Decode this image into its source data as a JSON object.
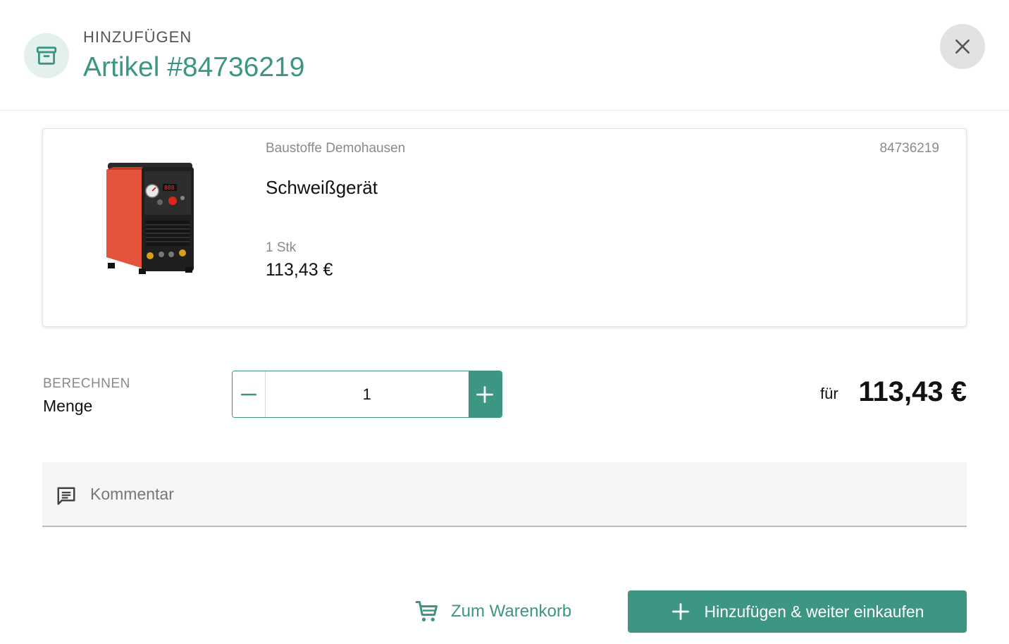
{
  "dialog": {
    "overline": "HINZUFÜGEN",
    "title": "Artikel #84736219",
    "icon": "archive-box-icon",
    "close_icon": "close-icon"
  },
  "product": {
    "supplier": "Baustoffe Demohausen",
    "article_number": "84736219",
    "name": "Schweißgerät",
    "unit": "1 Stk",
    "unit_price": "113,43 €",
    "image": "welding-machine-image"
  },
  "calculation": {
    "overline": "BERECHNEN",
    "label": "Menge",
    "quantity": "1",
    "minus_icon": "minus-icon",
    "plus_icon": "plus-icon",
    "for_label": "für",
    "total": "113,43 €"
  },
  "comment": {
    "placeholder": "Kommentar",
    "value": "",
    "icon": "comment-icon"
  },
  "actions": {
    "cart_label": "Zum Warenkorb",
    "cart_icon": "shopping-cart-icon",
    "add_label": "Hinzufügen & weiter einkaufen",
    "add_icon": "plus-icon"
  },
  "colors": {
    "accent": "#3d9583",
    "accent_light": "#e3f0ed",
    "close_bg": "#e2e2e2"
  }
}
